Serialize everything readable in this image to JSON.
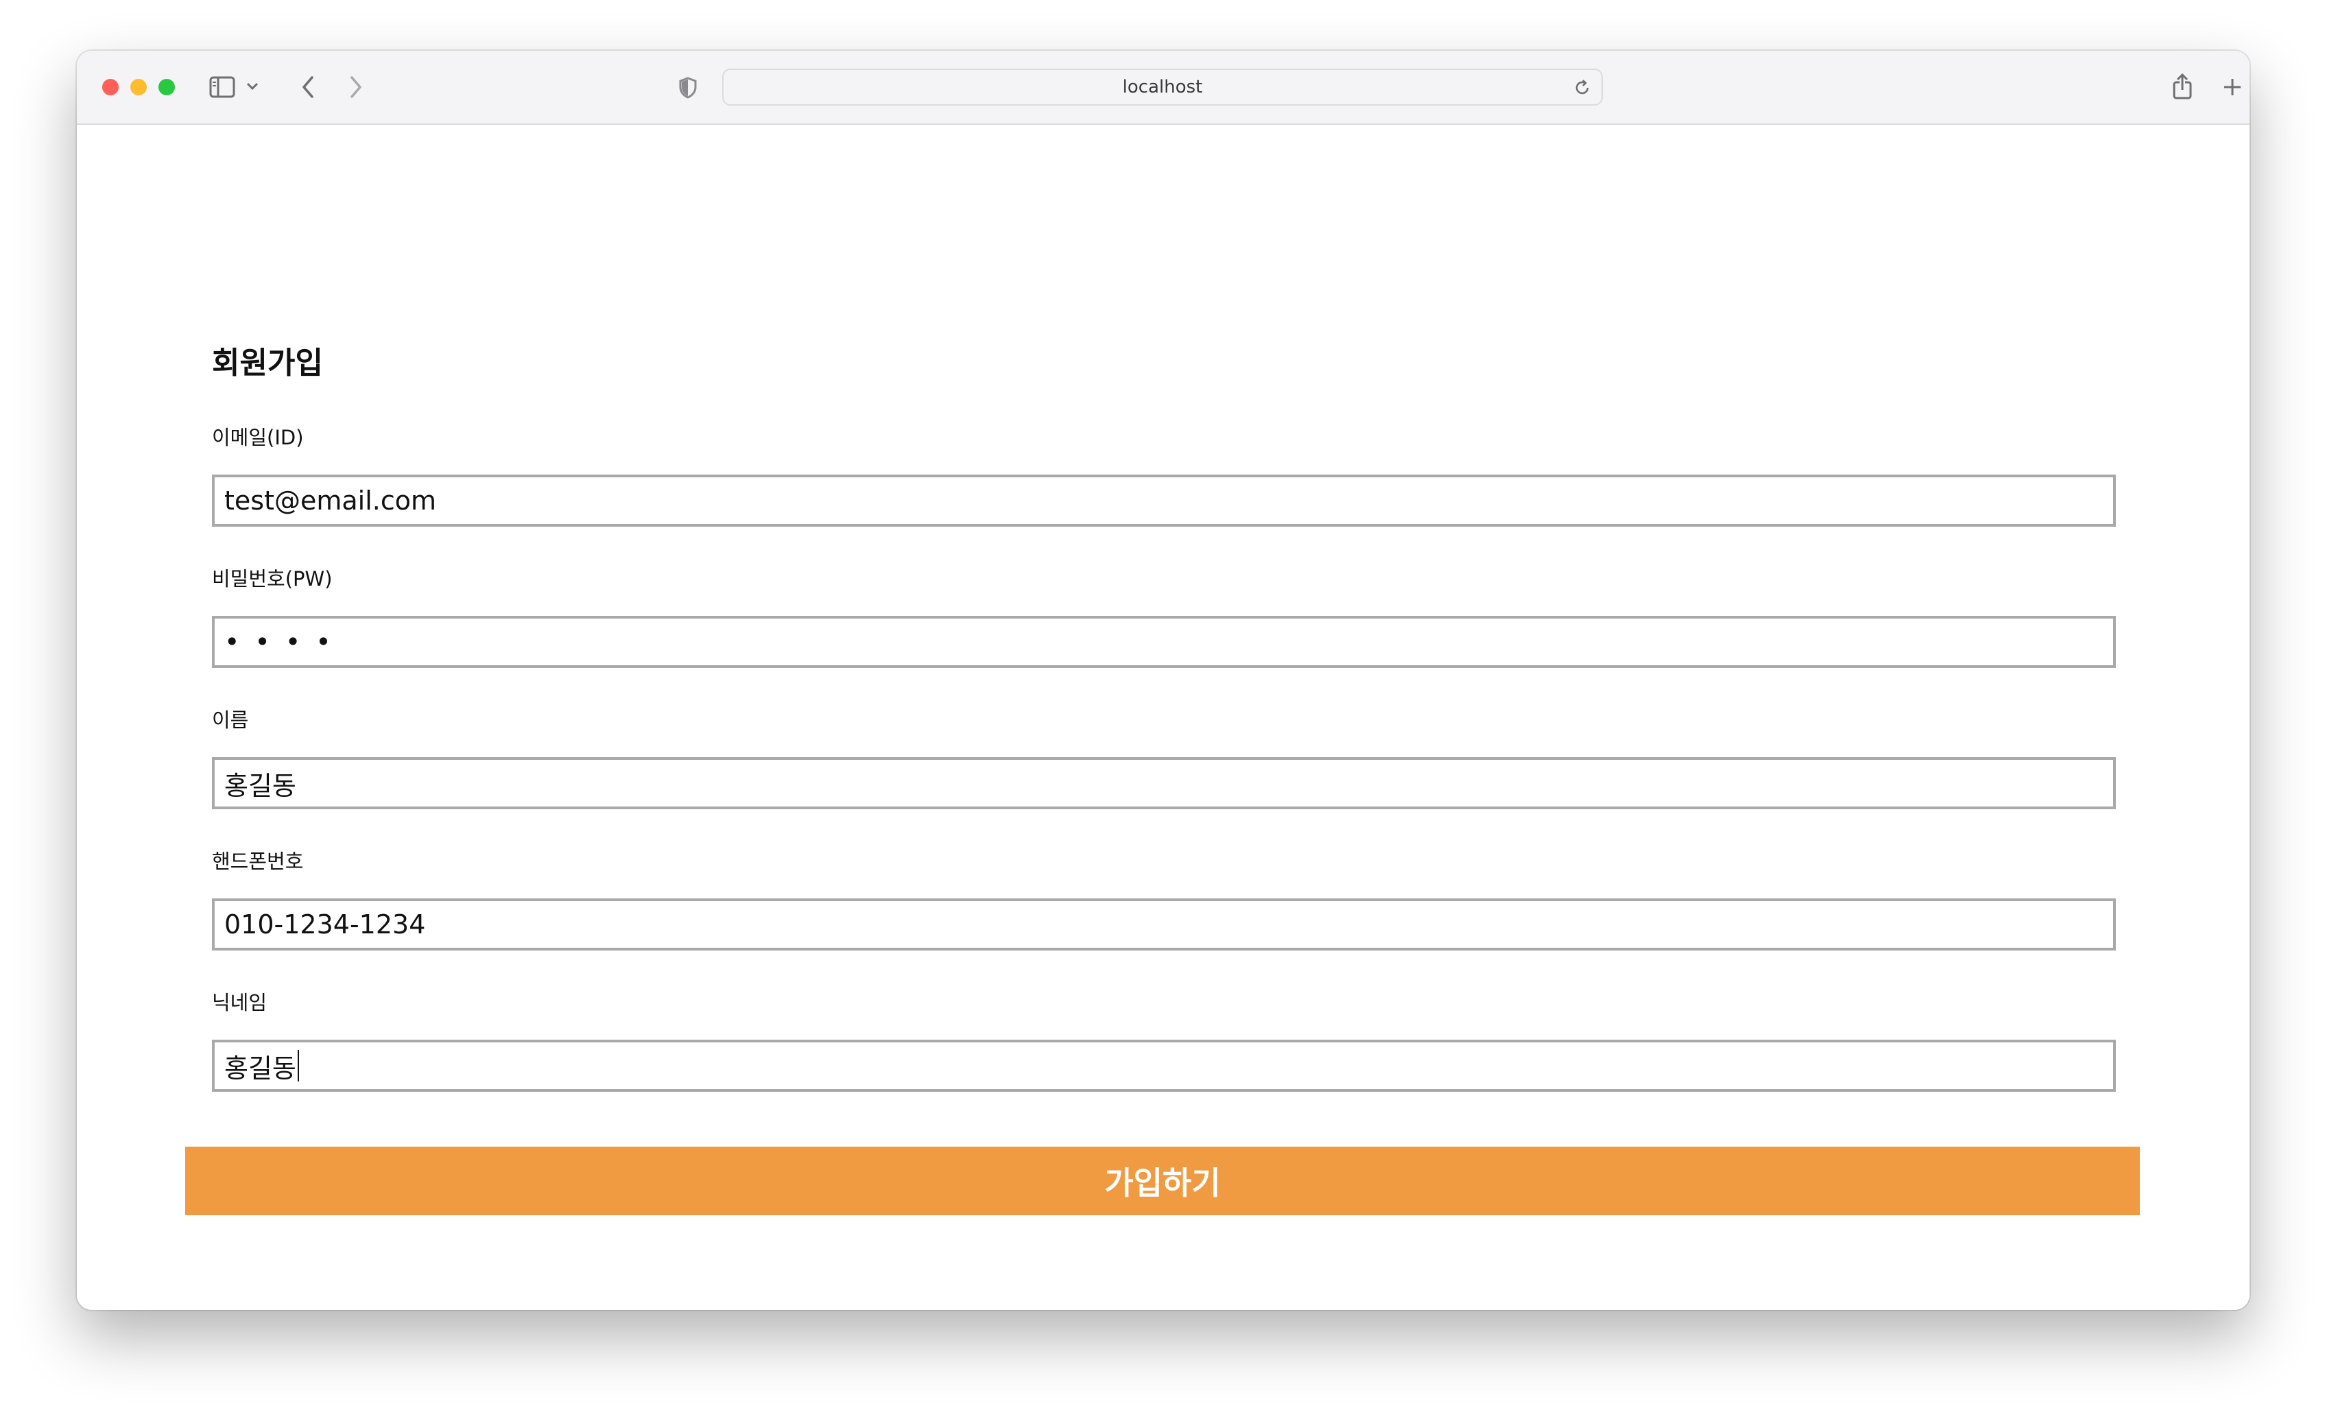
{
  "browser": {
    "url": "localhost",
    "traffic_lights": {
      "close": "#ff5f57",
      "minimize": "#febc2e",
      "zoom": "#28c840"
    },
    "icons": [
      "sidebar-icon",
      "chevron-down-icon",
      "back-icon",
      "forward-icon",
      "privacy-shield-icon",
      "reload-icon",
      "share-icon",
      "new-tab-icon",
      "tabs-overview-icon"
    ]
  },
  "form": {
    "title": "회원가입",
    "fields": [
      {
        "label": "이메일(ID)",
        "value": "test@email.com"
      },
      {
        "label": "비밀번호(PW)",
        "value": "••••"
      },
      {
        "label": "이름",
        "value": "홍길동"
      },
      {
        "label": "핸드폰번호",
        "value": "010-1234-1234"
      },
      {
        "label": "닉네임",
        "value": "홍길동"
      }
    ],
    "submit_label": "가입하기",
    "accent_color": "#f09a41"
  }
}
